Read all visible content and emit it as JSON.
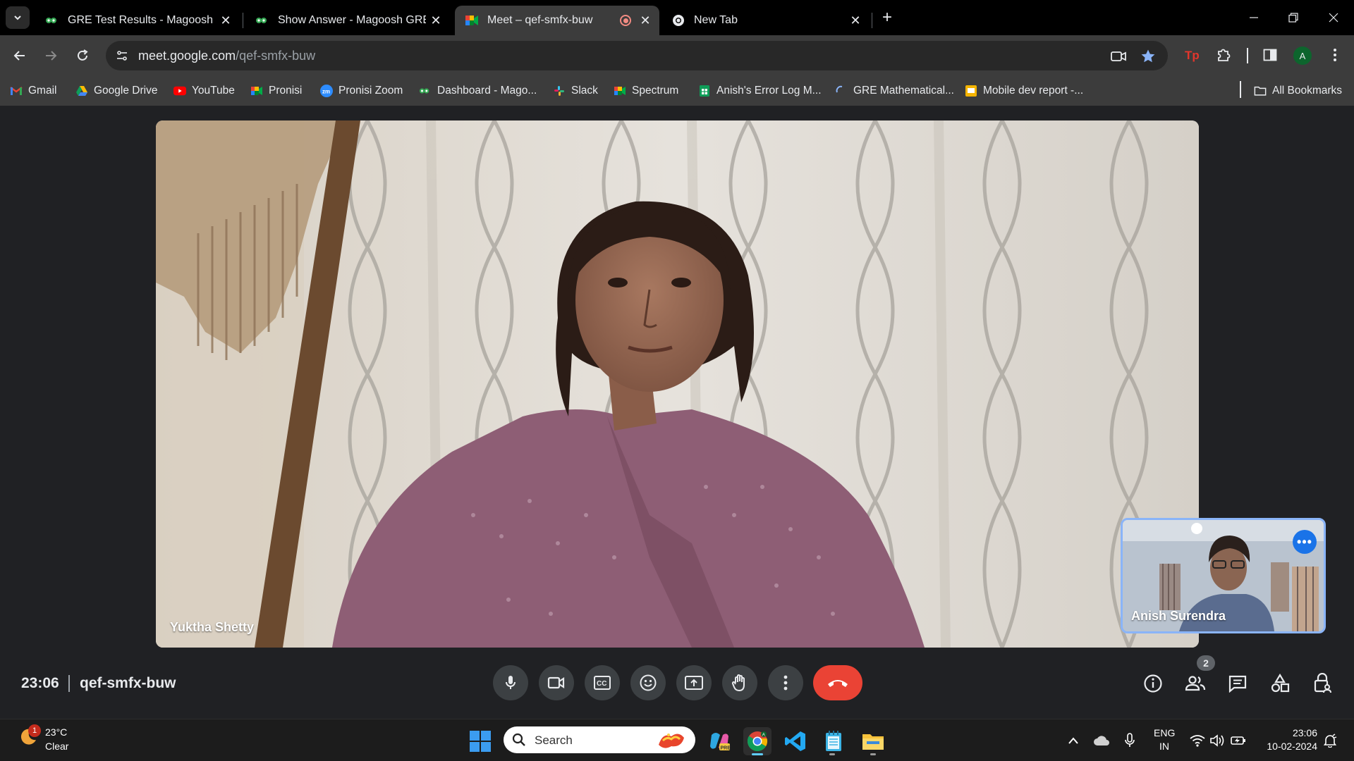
{
  "browser": {
    "tabs": [
      {
        "title": "GRE Test Results - Magoosh GRE",
        "icon": "magoosh-favicon"
      },
      {
        "title": "Show Answer - Magoosh GRE",
        "icon": "magoosh-favicon"
      },
      {
        "title": "Meet – qef-smfx-buw",
        "icon": "google-meet-favicon",
        "active": true,
        "recording": true
      },
      {
        "title": "New Tab",
        "icon": "chrome-favicon"
      }
    ],
    "url_host": "meet.google.com",
    "url_path": "/qef-smfx-buw",
    "profile_initial": "A",
    "colors": {
      "frame": "#000000",
      "toolbar": "#3c3c3c",
      "omnibox": "#282828",
      "star": "#8ab4f8"
    }
  },
  "bookmarks": {
    "items": [
      {
        "label": "Gmail",
        "icon": "gmail-icon"
      },
      {
        "label": "Google Drive",
        "icon": "google-drive-icon"
      },
      {
        "label": "YouTube",
        "icon": "youtube-icon"
      },
      {
        "label": "Pronisi",
        "icon": "google-meet-icon"
      },
      {
        "label": "Pronisi Zoom",
        "icon": "zoom-icon"
      },
      {
        "label": "Dashboard - Mago...",
        "icon": "magoosh-icon"
      },
      {
        "label": "Slack",
        "icon": "slack-icon"
      },
      {
        "label": "Spectrum",
        "icon": "google-meet-icon"
      },
      {
        "label": "Anish's Error Log M...",
        "icon": "google-sheets-icon"
      },
      {
        "label": "GRE Mathematical...",
        "icon": "loading-icon"
      },
      {
        "label": "Mobile dev report -...",
        "icon": "google-slides-icon"
      }
    ],
    "all_bookmarks": "All Bookmarks"
  },
  "meet": {
    "main_participant": "Yuktha Shetty",
    "self_participant": "Anish Surendra",
    "time": "23:06",
    "meeting_code": "qef-smfx-buw",
    "people_count": "2",
    "colors": {
      "end_call": "#ea4335",
      "button": "#3c4043",
      "self_border": "#8ab4f8"
    }
  },
  "taskbar": {
    "weather_badge": "1",
    "temperature": "23°C",
    "weather": "Clear",
    "search_placeholder": "Search",
    "lang_line1": "ENG",
    "lang_line2": "IN",
    "clock_time": "23:06",
    "clock_date": "10-02-2024"
  }
}
